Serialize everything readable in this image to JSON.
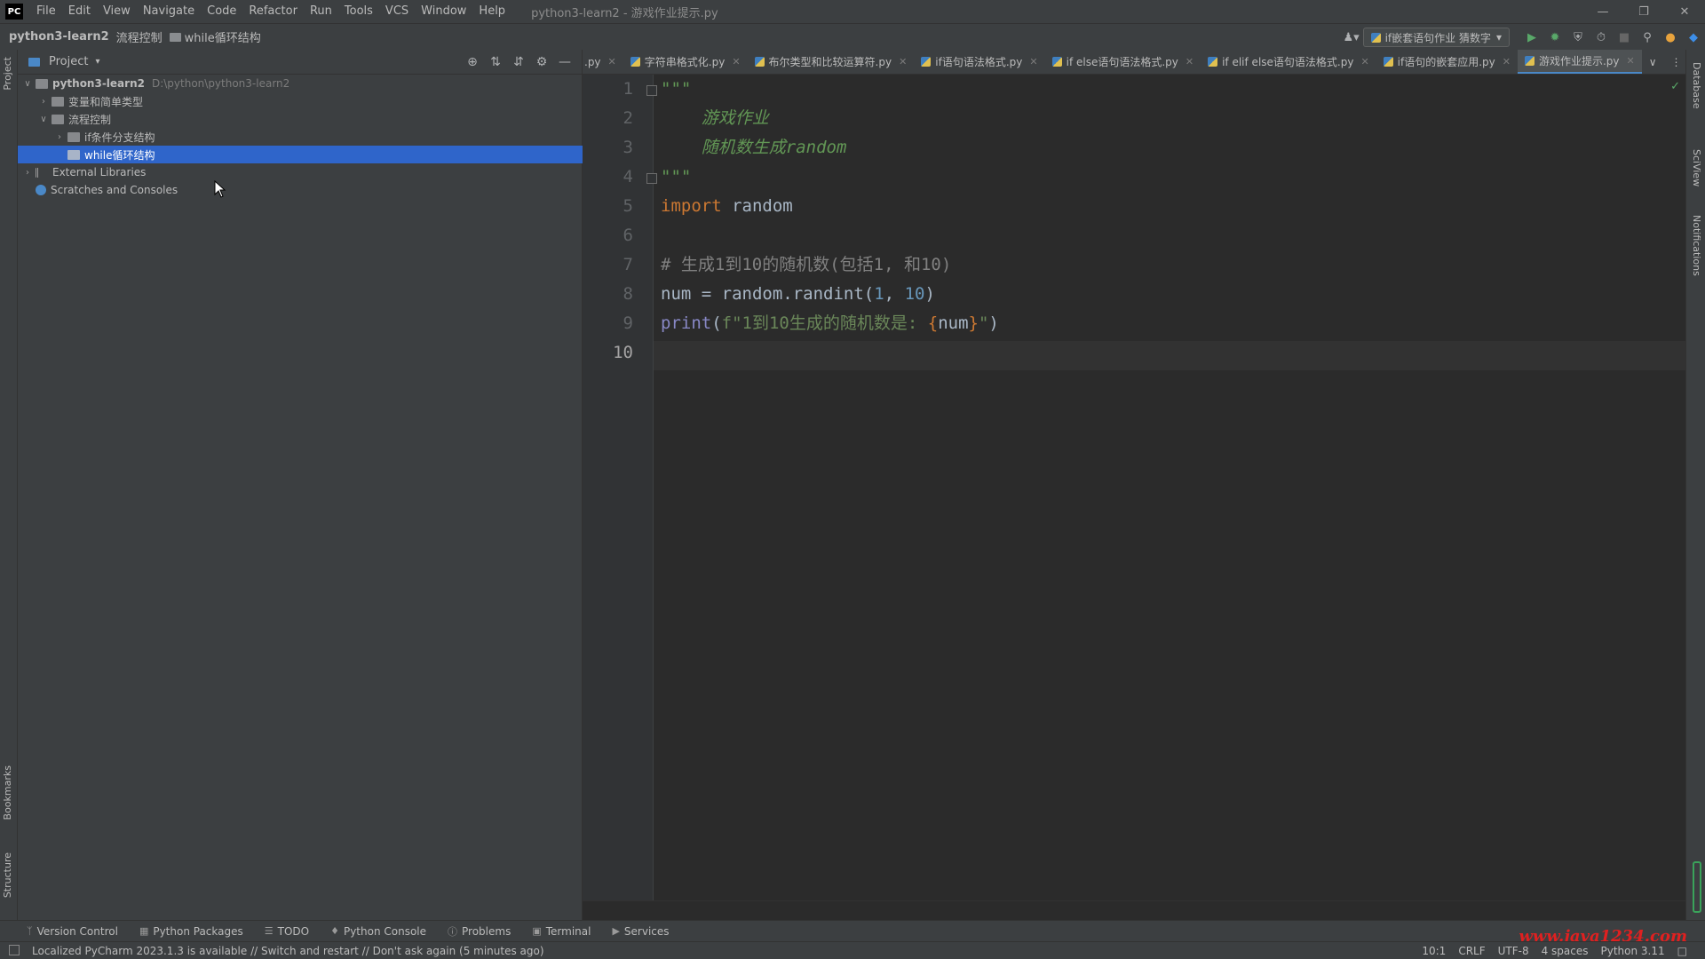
{
  "titlebar": {
    "logo": "PC",
    "menu": [
      "File",
      "Edit",
      "View",
      "Navigate",
      "Code",
      "Refactor",
      "Run",
      "Tools",
      "VCS",
      "Window",
      "Help"
    ],
    "window_title": "python3-learn2 - 游戏作业提示.py"
  },
  "navbar": {
    "crumbs": [
      "python3-learn2",
      "流程控制",
      "while循环结构"
    ],
    "run_config": "if嵌套语句作业 猜数字"
  },
  "project": {
    "title": "Project",
    "tree": [
      {
        "label": "python3-learn2",
        "path": "D:\\python\\python3-learn2"
      },
      {
        "label": "变量和简单类型"
      },
      {
        "label": "流程控制"
      },
      {
        "label": "if条件分支结构"
      },
      {
        "label": "while循环结构"
      },
      {
        "label": "External Libraries"
      },
      {
        "label": "Scratches and Consoles"
      }
    ]
  },
  "tabs": [
    {
      "label": ".py"
    },
    {
      "label": "字符串格式化.py"
    },
    {
      "label": "布尔类型和比较运算符.py"
    },
    {
      "label": "if语句语法格式.py"
    },
    {
      "label": "if else语句语法格式.py"
    },
    {
      "label": "if elif else语句语法格式.py"
    },
    {
      "label": "if语句的嵌套应用.py"
    },
    {
      "label": "游戏作业提示.py"
    }
  ],
  "editor": {
    "line_numbers": [
      "1",
      "2",
      "3",
      "4",
      "5",
      "6",
      "7",
      "8",
      "9",
      "10"
    ],
    "lines": {
      "l1": "\"\"\"",
      "l2": "    游戏作业",
      "l3": "    随机数生成random",
      "l4": "\"\"\"",
      "l5_kw": "import",
      "l5_rest": " random",
      "l7": "# 生成1到10的随机数(包括1, 和10)",
      "l8_a": "num = random.randint(",
      "l8_n1": "1",
      "l8_sep": ", ",
      "l8_n2": "10",
      "l8_b": ")",
      "l9_fn": "print",
      "l9_open": "(",
      "l9_str": "f\"1到10生成的随机数是: ",
      "l9_br1": "{",
      "l9_var": "num",
      "l9_br2": "}",
      "l9_strend": "\"",
      "l9_close": ")"
    }
  },
  "left_strip": {
    "project": "Project",
    "bookmarks": "Bookmarks",
    "structure": "Structure"
  },
  "right_strip": {
    "database": "Database",
    "sciview": "SciView",
    "notifications": "Notifications"
  },
  "bottom_tools": [
    "Version Control",
    "Python Packages",
    "TODO",
    "Python Console",
    "Problems",
    "Terminal",
    "Services"
  ],
  "status": {
    "message": "Localized PyCharm 2023.1.3 is available // Switch and restart // Don't ask again (5 minutes ago)",
    "position": "10:1",
    "line_sep": "CRLF",
    "encoding": "UTF-8",
    "indent": "4 spaces",
    "interpreter": "Python 3.11"
  },
  "watermark": "www.java1234.com"
}
